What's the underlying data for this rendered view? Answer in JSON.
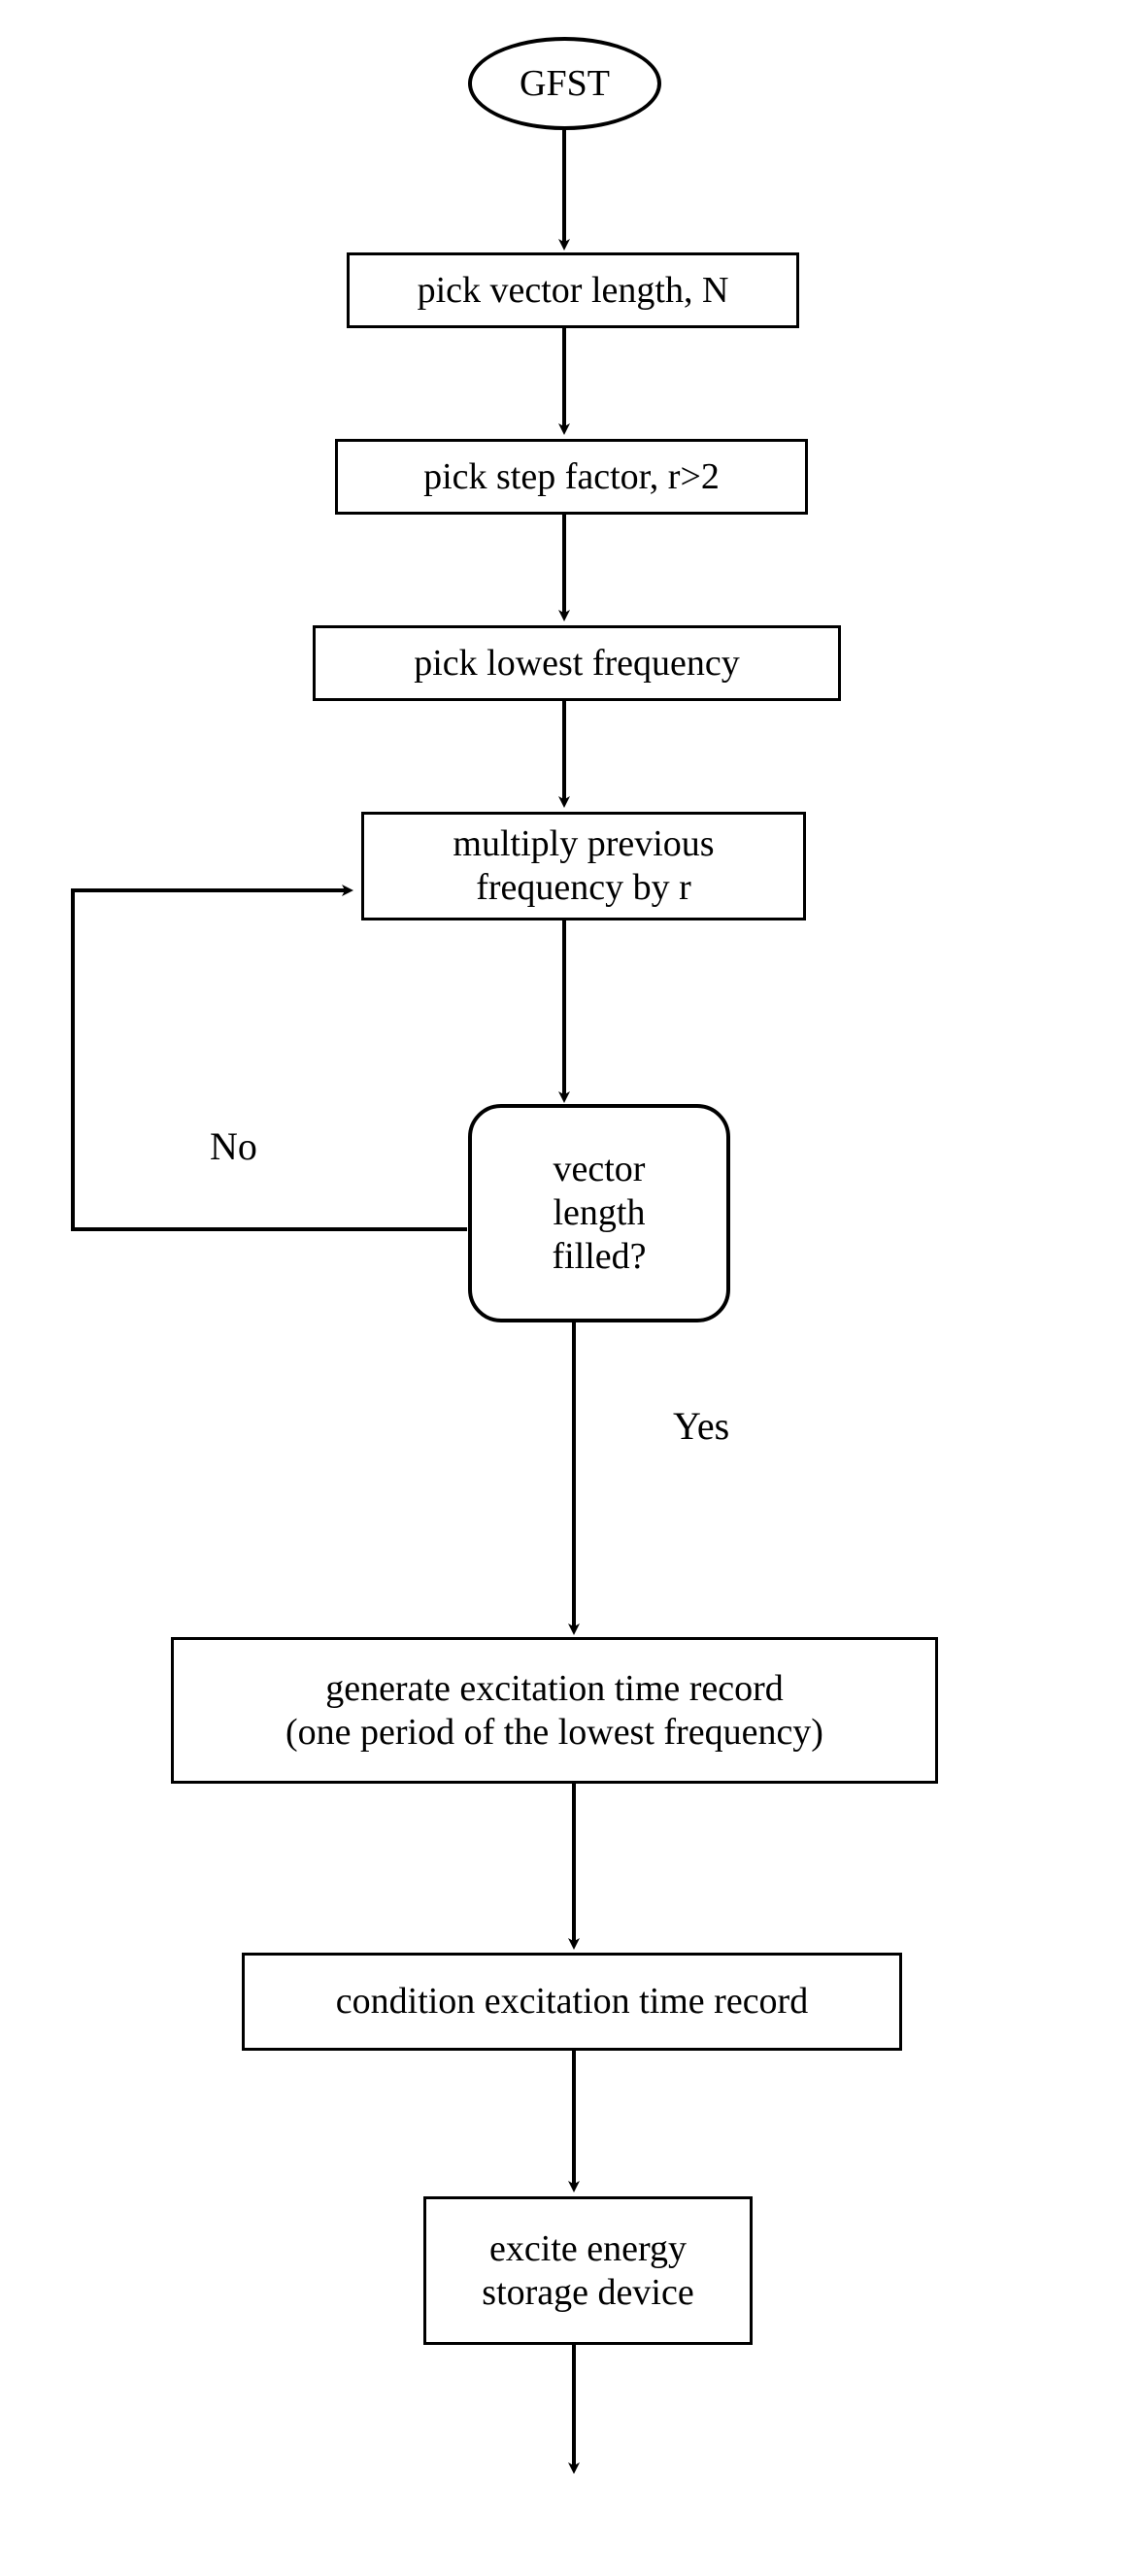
{
  "diagram": {
    "title": "GFST",
    "type": "flowchart",
    "orientation": "vertical",
    "background_color": "#ffffff",
    "line_color": "#000000",
    "text_color": "#000000"
  },
  "nodes": {
    "start": {
      "id": "start",
      "shape": "ellipse",
      "label": "GFST"
    },
    "pick_vector_length": {
      "id": "pick_vector_length",
      "shape": "rectangle",
      "label": "pick vector length, N"
    },
    "pick_step_factor": {
      "id": "pick_step_factor",
      "shape": "rectangle",
      "label": "pick step factor, r>2"
    },
    "pick_lowest_frequency": {
      "id": "pick_lowest_frequency",
      "shape": "rectangle",
      "label": "pick lowest frequency"
    },
    "multiply_previous": {
      "id": "multiply_previous",
      "shape": "rectangle",
      "label": "multiply previous\nfrequency by r"
    },
    "vector_filled": {
      "id": "vector_filled",
      "shape": "rounded-rectangle",
      "label": "vector\nlength\nfilled?"
    },
    "generate_excitation": {
      "id": "generate_excitation",
      "shape": "rectangle",
      "label": "generate excitation time record\n(one period of the lowest frequency)"
    },
    "condition_excitation": {
      "id": "condition_excitation",
      "shape": "rectangle",
      "label": "condition excitation time record"
    },
    "excite_device": {
      "id": "excite_device",
      "shape": "rectangle",
      "label": "excite energy\nstorage device"
    }
  },
  "edge_labels": {
    "no": "No",
    "yes": "Yes"
  },
  "edges": [
    {
      "from": "start",
      "to": "pick_vector_length",
      "label": ""
    },
    {
      "from": "pick_vector_length",
      "to": "pick_step_factor",
      "label": ""
    },
    {
      "from": "pick_step_factor",
      "to": "pick_lowest_frequency",
      "label": ""
    },
    {
      "from": "pick_lowest_frequency",
      "to": "multiply_previous",
      "label": ""
    },
    {
      "from": "multiply_previous",
      "to": "vector_filled",
      "label": ""
    },
    {
      "from": "vector_filled",
      "to": "multiply_previous",
      "label": "No"
    },
    {
      "from": "vector_filled",
      "to": "generate_excitation",
      "label": "Yes"
    },
    {
      "from": "generate_excitation",
      "to": "condition_excitation",
      "label": ""
    },
    {
      "from": "condition_excitation",
      "to": "excite_device",
      "label": ""
    },
    {
      "from": "excite_device",
      "to": "",
      "label": ""
    }
  ]
}
